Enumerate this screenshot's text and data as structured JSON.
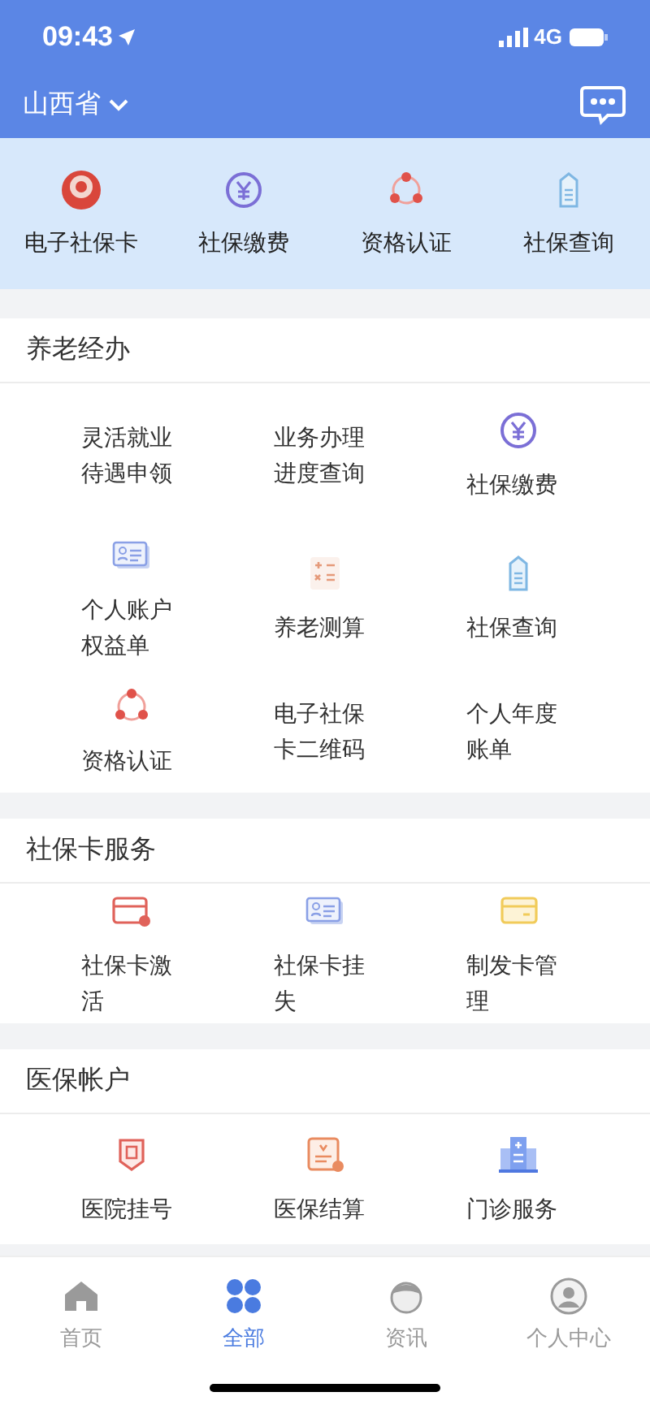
{
  "status_bar": {
    "time": "09:43",
    "network": "4G"
  },
  "header": {
    "region": "山西省"
  },
  "quick_actions": [
    {
      "label": "电子社保卡",
      "kind": "badge"
    },
    {
      "label": "社保缴费",
      "kind": "yen"
    },
    {
      "label": "资格认证",
      "kind": "network"
    },
    {
      "label": "社保查询",
      "kind": "tag"
    }
  ],
  "sections": [
    {
      "title": "养老经办",
      "items": [
        {
          "label": "灵活就业待遇申领",
          "kind": "text"
        },
        {
          "label": "业务办理进度查询",
          "kind": "text"
        },
        {
          "label": "社保缴费",
          "kind": "yen"
        },
        {
          "label": "个人账户权益单",
          "kind": "idcard"
        },
        {
          "label": "养老测算",
          "kind": "calc"
        },
        {
          "label": "社保查询",
          "kind": "tag"
        },
        {
          "label": "资格认证",
          "kind": "network"
        },
        {
          "label": "电子社保卡二维码",
          "kind": "text"
        },
        {
          "label": "个人年度账单",
          "kind": "text"
        }
      ]
    },
    {
      "title": "社保卡服务",
      "items": [
        {
          "label": "社保卡激活",
          "kind": "cardlock"
        },
        {
          "label": "社保卡挂失",
          "kind": "idcard"
        },
        {
          "label": "制发卡管理",
          "kind": "cardyellow"
        }
      ]
    },
    {
      "title": "医保帐户",
      "items": [
        {
          "label": "医院挂号",
          "kind": "shield"
        },
        {
          "label": "医保结算",
          "kind": "receipt"
        },
        {
          "label": "门诊服务",
          "kind": "building"
        }
      ]
    }
  ],
  "tab_bar": [
    {
      "label": "首页",
      "kind": "home",
      "selected": false
    },
    {
      "label": "全部",
      "kind": "grid",
      "selected": true
    },
    {
      "label": "资讯",
      "kind": "face",
      "selected": false
    },
    {
      "label": "个人中心",
      "kind": "user",
      "selected": false
    }
  ]
}
